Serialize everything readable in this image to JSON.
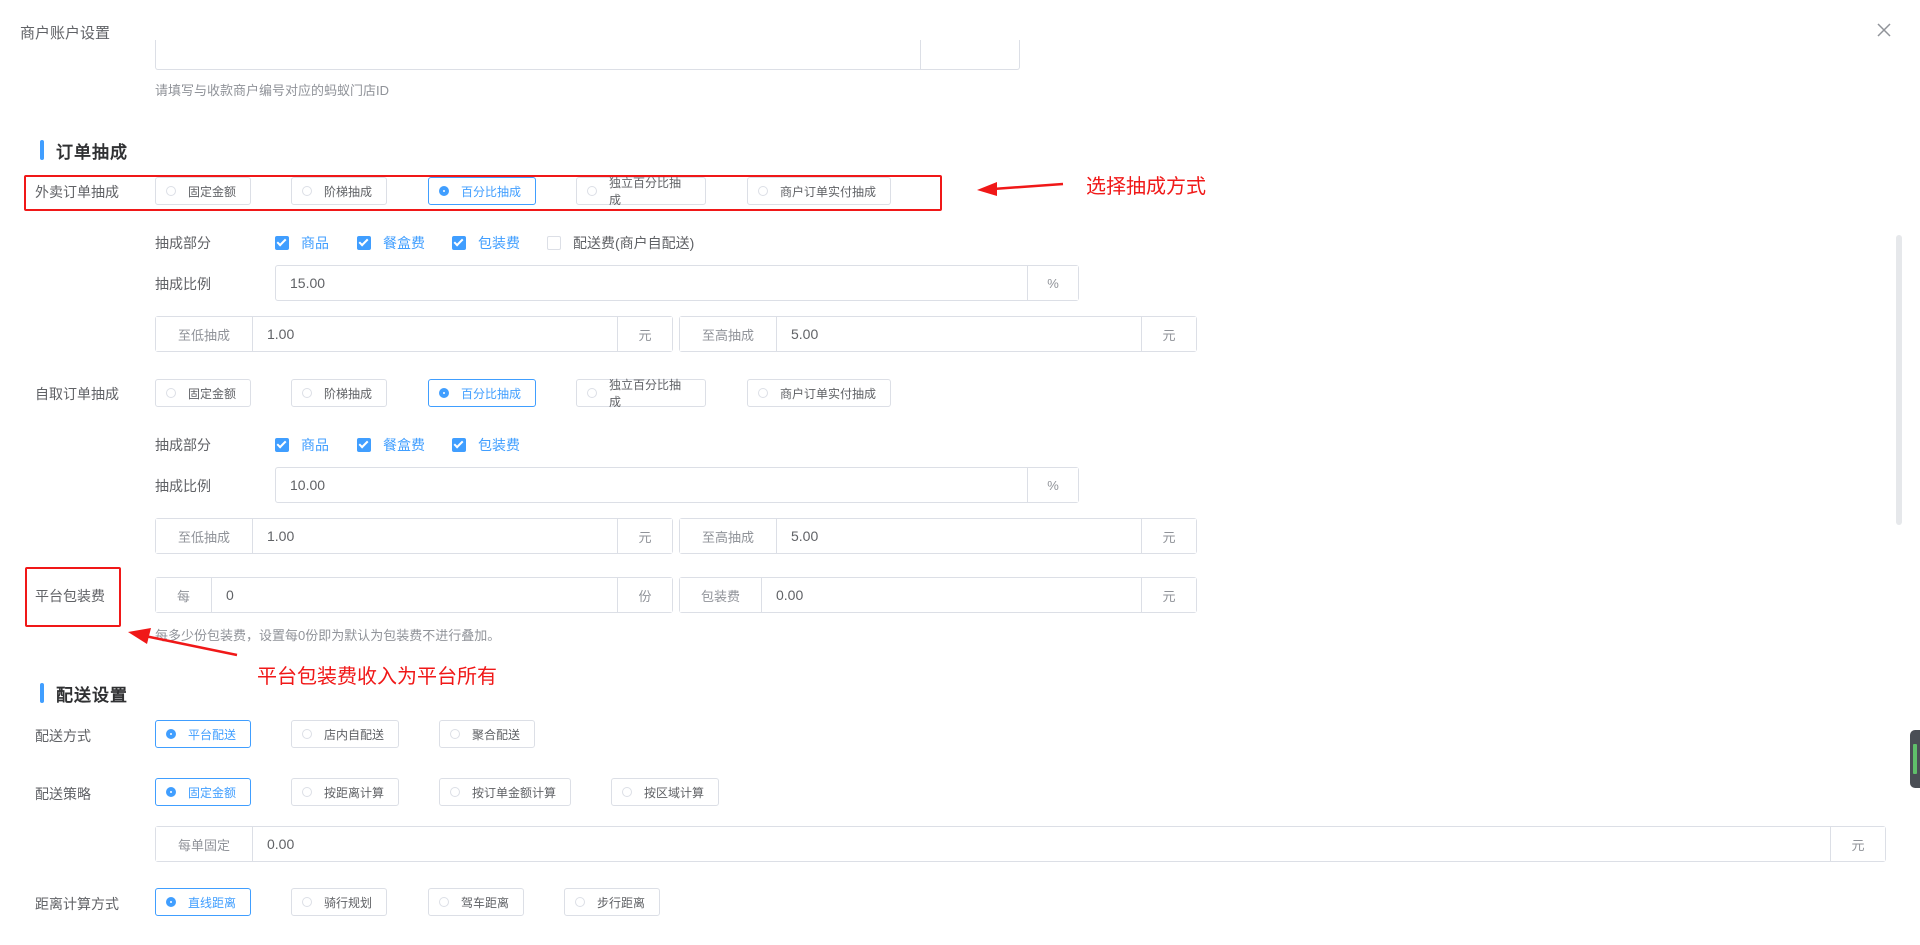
{
  "dialog": {
    "title": "商户账户设置"
  },
  "store_hint": "请填写与收款商户编号对应的蚂蚁门店ID",
  "order_commission": {
    "section_title": "订单抽成",
    "delivery": {
      "label": "外卖订单抽成",
      "options": [
        "固定金额",
        "阶梯抽成",
        "百分比抽成",
        "独立百分比抽成",
        "商户订单实付抽成"
      ],
      "selected_index": 2,
      "parts_label": "抽成部分",
      "parts": [
        {
          "label": "商品",
          "checked": true
        },
        {
          "label": "餐盒费",
          "checked": true
        },
        {
          "label": "包装费",
          "checked": true
        },
        {
          "label": "配送费(商户自配送)",
          "checked": false
        }
      ],
      "ratio_label": "抽成比例",
      "ratio_value": "15.00",
      "ratio_unit": "%",
      "min_label": "至低抽成",
      "min_value": "1.00",
      "min_unit": "元",
      "max_label": "至高抽成",
      "max_value": "5.00",
      "max_unit": "元"
    },
    "pickup": {
      "label": "自取订单抽成",
      "options": [
        "固定金额",
        "阶梯抽成",
        "百分比抽成",
        "独立百分比抽成",
        "商户订单实付抽成"
      ],
      "selected_index": 2,
      "parts_label": "抽成部分",
      "parts": [
        {
          "label": "商品",
          "checked": true
        },
        {
          "label": "餐盒费",
          "checked": true
        },
        {
          "label": "包装费",
          "checked": true
        }
      ],
      "ratio_label": "抽成比例",
      "ratio_value": "10.00",
      "ratio_unit": "%",
      "min_label": "至低抽成",
      "min_value": "1.00",
      "min_unit": "元",
      "max_label": "至高抽成",
      "max_value": "5.00",
      "max_unit": "元"
    },
    "packaging": {
      "label": "平台包装费",
      "per_label": "每",
      "per_value": "0",
      "per_unit": "份",
      "fee_label": "包装费",
      "fee_value": "0.00",
      "fee_unit": "元",
      "hint": "每多少份包装费，设置每0份即为默认为包装费不进行叠加。"
    }
  },
  "delivery_settings": {
    "section_title": "配送设置",
    "method": {
      "label": "配送方式",
      "options": [
        "平台配送",
        "店内自配送",
        "聚合配送"
      ],
      "selected_index": 0
    },
    "strategy": {
      "label": "配送策略",
      "options": [
        "固定金额",
        "按距离计算",
        "按订单金额计算",
        "按区域计算"
      ],
      "selected_index": 0
    },
    "fixed": {
      "label": "每单固定",
      "value": "0.00",
      "unit": "元"
    },
    "distance": {
      "label": "距离计算方式",
      "options": [
        "直线距离",
        "骑行规划",
        "驾车距离",
        "步行距离"
      ],
      "selected_index": 0
    }
  },
  "annotations": {
    "choose_method": "选择抽成方式",
    "platform_income": "平台包装费收入为平台所有",
    "color": "#f01818"
  },
  "colors": {
    "primary": "#409eff",
    "border": "#dcdfe6",
    "text": "#606266",
    "annotation": "#f01818"
  }
}
